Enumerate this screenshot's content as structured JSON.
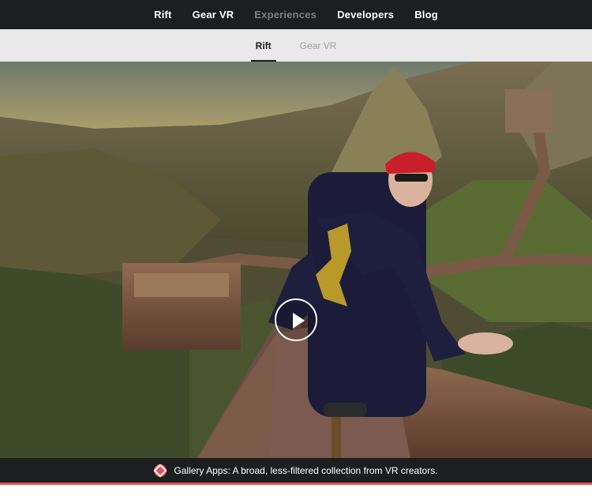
{
  "nav": {
    "items": [
      {
        "label": "Rift",
        "active": false
      },
      {
        "label": "Gear VR",
        "active": false
      },
      {
        "label": "Experiences",
        "active": true
      },
      {
        "label": "Developers",
        "active": false
      },
      {
        "label": "Blog",
        "active": false
      }
    ]
  },
  "subnav": {
    "tabs": [
      {
        "label": "Rift",
        "selected": true
      },
      {
        "label": "Gear VR",
        "selected": false
      }
    ]
  },
  "hero": {
    "play_icon": "play-circle-icon"
  },
  "banner": {
    "icon": "gallery-icon",
    "text": "Gallery Apps: A broad, less-filtered collection from VR creators."
  },
  "colors": {
    "nav_bg": "#1c1e20",
    "subnav_bg": "#e9e9e9",
    "accent": "#e0535a"
  }
}
